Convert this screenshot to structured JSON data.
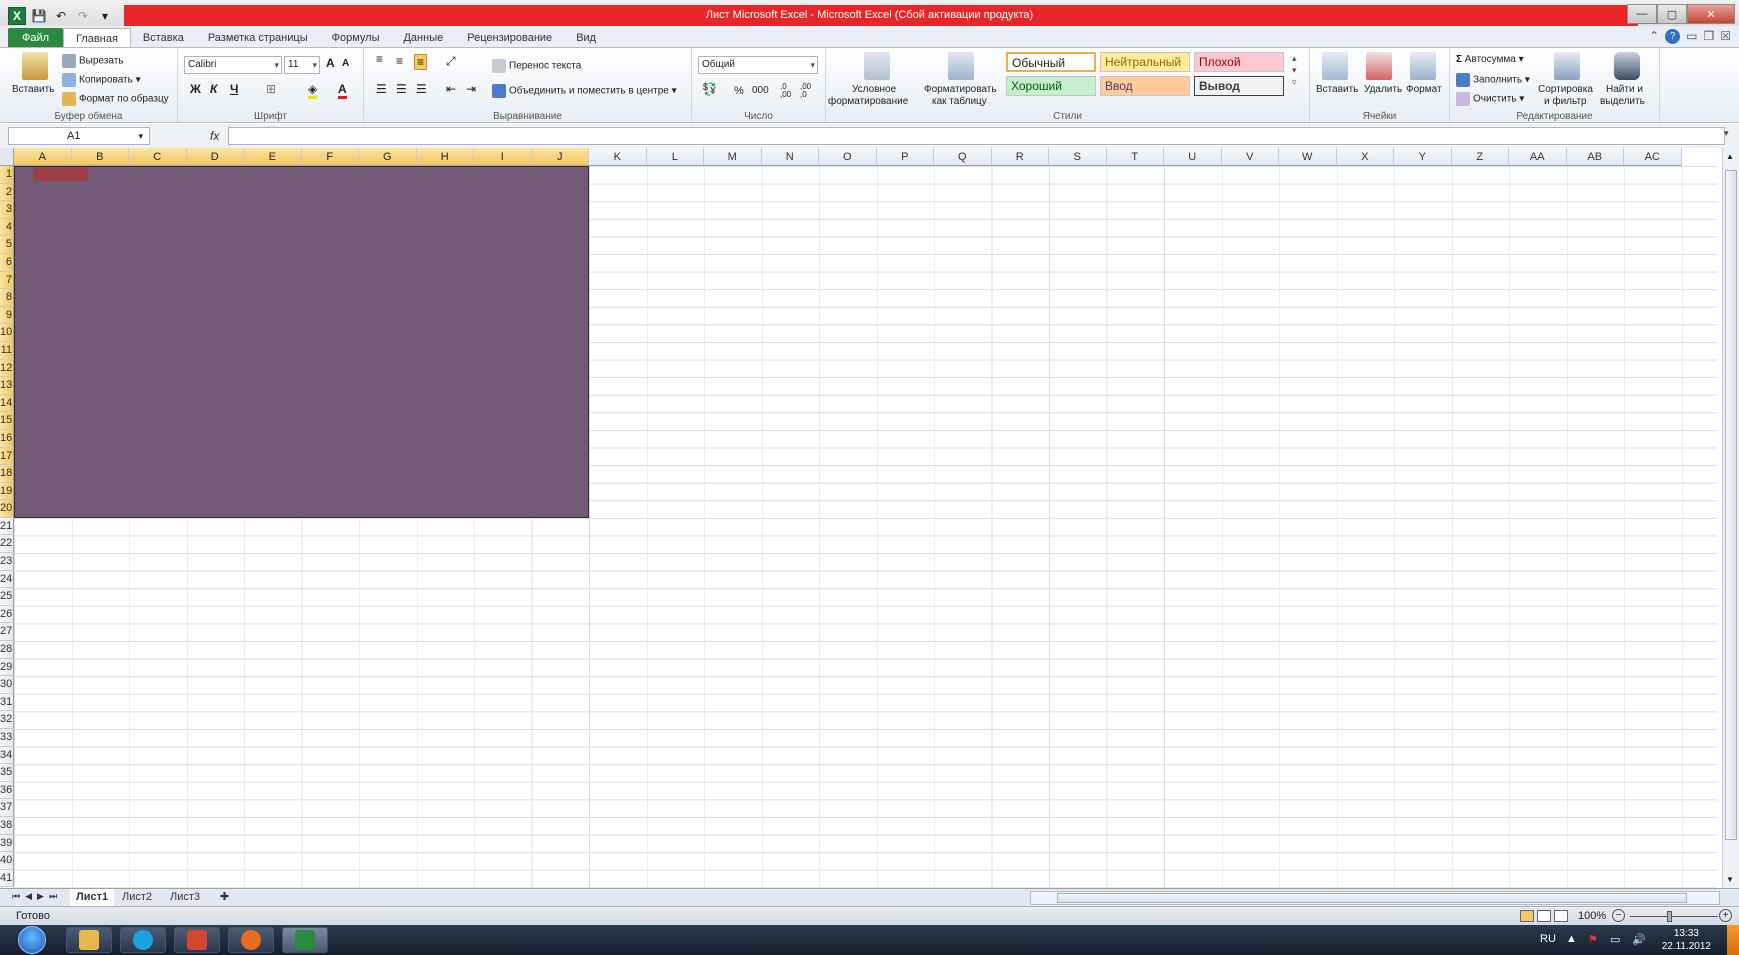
{
  "window": {
    "title": "Лист Microsoft Excel - Microsoft Excel (Сбой активации продукта)",
    "accent_bar_color": "#e8262a"
  },
  "qat": {
    "app_icon": "X",
    "save_icon": "save-icon",
    "undo_icon": "undo-icon",
    "redo_icon": "redo-icon"
  },
  "tabs": [
    {
      "label": "Файл"
    },
    {
      "label": "Главная"
    },
    {
      "label": "Вставка"
    },
    {
      "label": "Разметка страницы"
    },
    {
      "label": "Формулы"
    },
    {
      "label": "Данные"
    },
    {
      "label": "Рецензирование"
    },
    {
      "label": "Вид"
    }
  ],
  "ribbon": {
    "clipboard": {
      "paste": "Вставить",
      "cut": "Вырезать",
      "copy": "Копировать",
      "format_painter": "Формат по образцу",
      "label": "Буфер обмена"
    },
    "font": {
      "name": "Calibri",
      "size": "11",
      "bold": "Ж",
      "italic": "К",
      "underline": "Ч",
      "grow": "A",
      "shrink": "A",
      "color": "A",
      "label": "Шрифт"
    },
    "alignment": {
      "wrap": "Перенос текста",
      "merge": "Объединить и поместить в центре",
      "label": "Выравнивание"
    },
    "number": {
      "format": "Общий",
      "percent": "%",
      "thousands": "000",
      "inc_dec": ",0 ,00",
      "dec_dec": ",00 ,0",
      "label": "Число"
    },
    "styles": {
      "conditional_1": "Условное",
      "conditional_2": "форматирование",
      "as_table_1": "Форматировать",
      "as_table_2": "как таблицу",
      "normal": "Обычный",
      "neutral": "Нейтральный",
      "bad": "Плохой",
      "good": "Хороший",
      "input": "Ввод",
      "output": "Вывод",
      "label": "Стили"
    },
    "cells": {
      "insert": "Вставить",
      "delete": "Удалить",
      "format": "Формат",
      "label": "Ячейки"
    },
    "editing": {
      "autosum": "Автосумма",
      "fill": "Заполнить",
      "clear": "Очистить",
      "sort_1": "Сортировка",
      "sort_2": "и фильтр",
      "find_1": "Найти и",
      "find_2": "выделить",
      "label": "Редактирование"
    }
  },
  "formula_bar": {
    "name_box": "A1",
    "fx": "fx",
    "value": ""
  },
  "sheet": {
    "columns": [
      "A",
      "B",
      "C",
      "D",
      "E",
      "F",
      "G",
      "H",
      "I",
      "J",
      "K",
      "L",
      "M",
      "N",
      "O",
      "P",
      "Q",
      "R",
      "S",
      "T",
      "U",
      "V",
      "W",
      "X",
      "Y",
      "Z",
      "AA",
      "AB",
      "AC"
    ],
    "rows": [
      "1",
      "2",
      "3",
      "4",
      "5",
      "6",
      "7",
      "8",
      "9",
      "10",
      "11",
      "12",
      "13",
      "14",
      "15",
      "16",
      "17",
      "18",
      "19",
      "20",
      "21",
      "22",
      "23",
      "24",
      "25",
      "26",
      "27",
      "28",
      "29",
      "30",
      "31",
      "32",
      "33",
      "34",
      "35",
      "36",
      "37",
      "38",
      "39",
      "40",
      "41"
    ],
    "selected_range": "A1:J20",
    "selected_columns": 10,
    "selected_rows": 20,
    "fill_color": "#735878",
    "active_cell_color": "#9d3f45"
  },
  "sheet_tabs": [
    {
      "label": "Лист1"
    },
    {
      "label": "Лист2"
    },
    {
      "label": "Лист3"
    }
  ],
  "status": {
    "ready": "Готово",
    "zoom": "100%",
    "zoom_out": "−",
    "zoom_in": "+"
  },
  "taskbar": {
    "apps": [
      {
        "name": "explorer",
        "color": "#e8b84a"
      },
      {
        "name": "skype",
        "color": "#1aa3e0"
      },
      {
        "name": "powerpoint",
        "color": "#d3482c"
      },
      {
        "name": "firefox",
        "color": "#e96b1e"
      },
      {
        "name": "excel",
        "color": "#2a8a3f"
      }
    ],
    "lang": "RU",
    "time": "13:33",
    "date": "22.11.2012"
  }
}
